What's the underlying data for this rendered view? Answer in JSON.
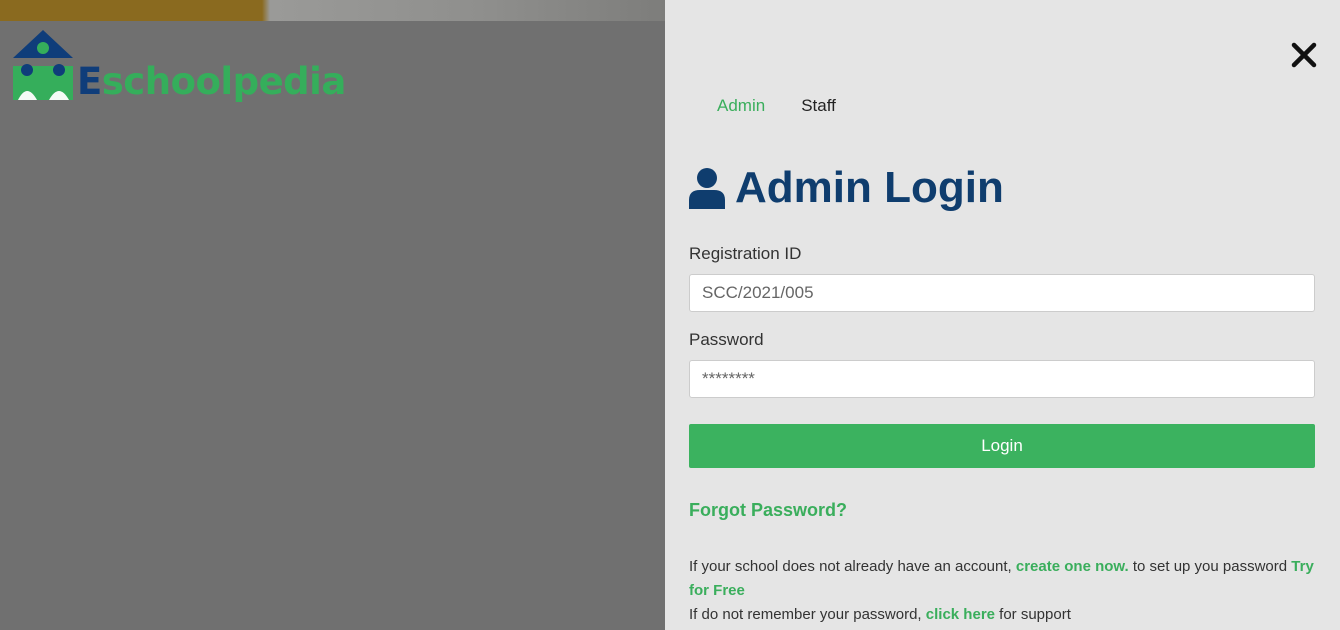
{
  "brand": {
    "logo_first_letter": "E",
    "logo_rest": "schoolpedia",
    "colors": {
      "navy": "#0f3d7a",
      "green": "#35ae5b"
    }
  },
  "panel": {
    "close_icon": "close-icon",
    "tabs": [
      {
        "label": "Admin",
        "active": true
      },
      {
        "label": "Staff",
        "active": false
      }
    ],
    "title": "Admin Login",
    "title_icon": "user-icon",
    "registration": {
      "label": "Registration ID",
      "placeholder": "SCC/2021/005"
    },
    "password": {
      "label": "Password",
      "placeholder": "********"
    },
    "login_label": "Login",
    "forgot_label": "Forgot Password?",
    "info": {
      "line1_prefix": "If your school does not already have an account, ",
      "line1_link": "create one now.",
      "line1_middle": " to set up you password ",
      "line1_link2": "Try for Free",
      "line2_prefix": "If do not remember your password, ",
      "line2_link": "click here",
      "line2_suffix": " for support"
    },
    "colors": {
      "accent": "#3bb25f",
      "title": "#0f3d6e",
      "panel_bg": "#e5e5e5"
    }
  }
}
